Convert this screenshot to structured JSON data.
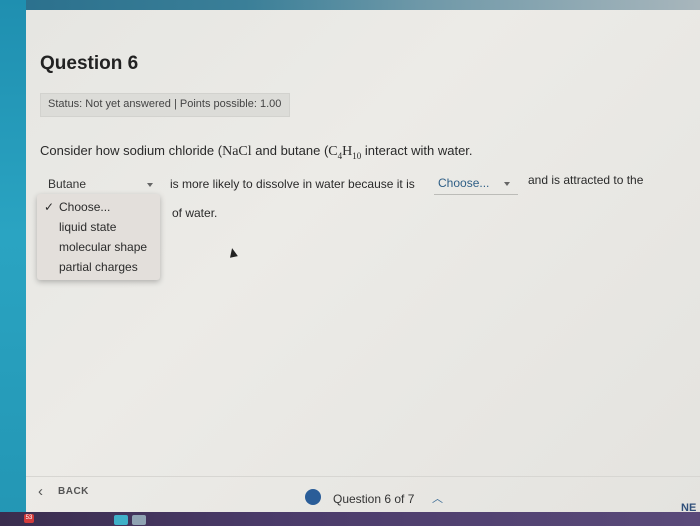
{
  "question": {
    "title": "Question 6",
    "status": "Status: Not yet answered | Points possible: 1.00",
    "prompt_prefix": "Consider how sodium chloride (",
    "nacl": "NaCl",
    "prompt_mid": " and butane (",
    "butane": {
      "c": "C",
      "c_sub": "4",
      "h": "H",
      "h_sub": "10"
    },
    "prompt_suffix": " interact with water."
  },
  "answer": {
    "left_select_value": "Butane",
    "text_1": "is more likely to dissolve in water because it is",
    "mid_select_value": "Choose...",
    "text_2": "and is attracted to the",
    "text_3": "of water."
  },
  "dropdown": {
    "check": "✓",
    "options": [
      "Choose...",
      "liquid state",
      "molecular shape",
      "partial charges"
    ],
    "selected_index": 0
  },
  "footer": {
    "back_label": "BACK",
    "question_count": "Question 6 of 7",
    "next_label": "NE"
  },
  "taskbar": {
    "badge": "53"
  },
  "colors": {
    "accent": "#2a5d98",
    "link": "#2f5f86"
  },
  "icons": {
    "back": "chevron-left-icon",
    "caret": "caret-down-icon",
    "up": "chevron-up-icon"
  }
}
